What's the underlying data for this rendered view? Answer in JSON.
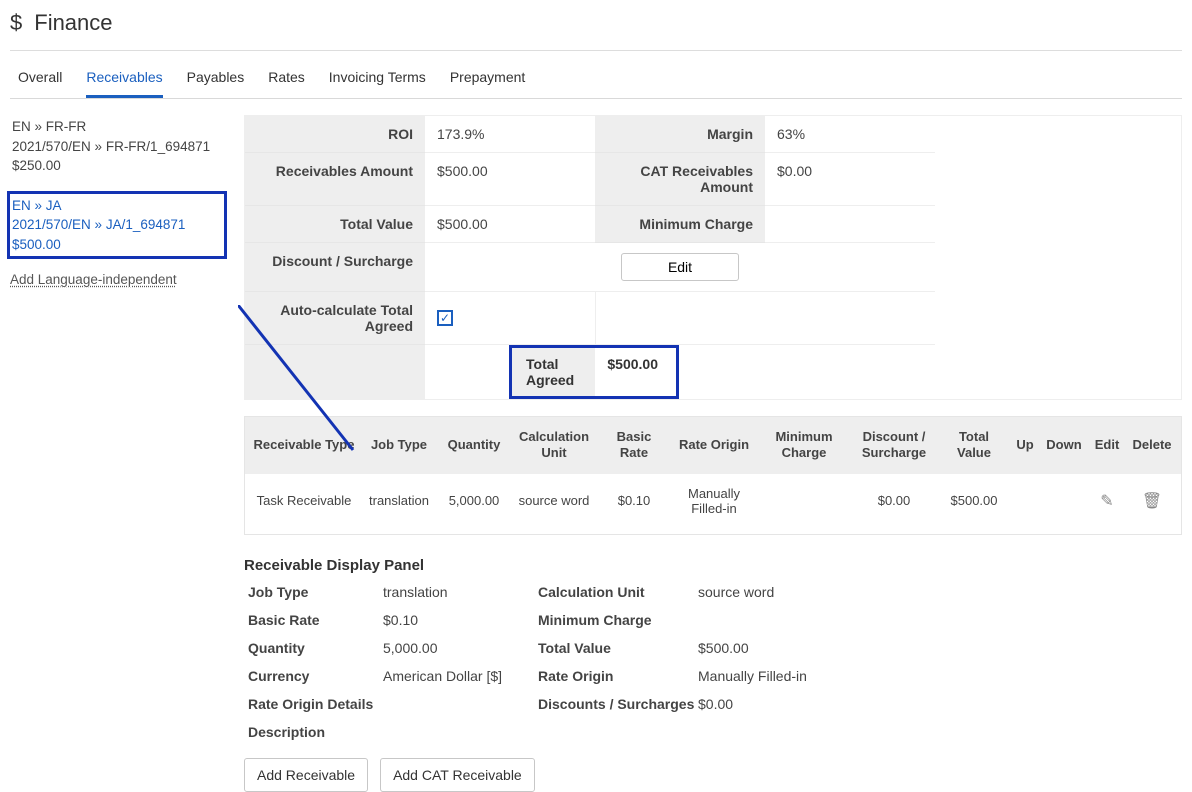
{
  "header": {
    "title": "Finance",
    "icon": "dollar-icon"
  },
  "tabs": {
    "items": [
      "Overall",
      "Receivables",
      "Payables",
      "Rates",
      "Invoicing Terms",
      "Prepayment"
    ],
    "active_index": 1
  },
  "sidebar": {
    "items": [
      {
        "pair": "EN » FR-FR",
        "ref": "2021/570/EN » FR-FR/1_694871",
        "amount": "$250.00",
        "active": false
      },
      {
        "pair": "EN » JA",
        "ref": "2021/570/EN » JA/1_694871",
        "amount": "$500.00",
        "active": true
      }
    ],
    "add_label": "Add Language-independent"
  },
  "summary": {
    "roi_label": "ROI",
    "roi": "173.9%",
    "margin_label": "Margin",
    "margin": "63%",
    "receivables_amount_label": "Receivables Amount",
    "receivables_amount": "$500.00",
    "cat_receivables_amount_label": "CAT Receivables Amount",
    "cat_receivables_amount": "$0.00",
    "total_value_label": "Total Value",
    "total_value": "$500.00",
    "minimum_charge_label": "Minimum Charge",
    "minimum_charge": "",
    "discount_label": "Discount / Surcharge",
    "edit_button": "Edit",
    "autocalc_label": "Auto-calculate Total Agreed",
    "autocalc_checked": true,
    "total_agreed_label": "Total Agreed",
    "total_agreed": "$500.00"
  },
  "table": {
    "headers": {
      "receivable_type": "Receivable Type",
      "job_type": "Job Type",
      "quantity": "Quantity",
      "calc_unit": "Calculation Unit",
      "basic_rate": "Basic Rate",
      "rate_origin": "Rate Origin",
      "min_charge": "Minimum Charge",
      "discount": "Discount / Surcharge",
      "total_value": "Total Value",
      "up": "Up",
      "down": "Down",
      "edit": "Edit",
      "delete": "Delete"
    },
    "rows": [
      {
        "receivable_type": "Task Receivable",
        "job_type": "translation",
        "quantity": "5,000.00",
        "calc_unit": "source word",
        "basic_rate": "$0.10",
        "rate_origin": "Manually Filled-in",
        "min_charge": "",
        "discount": "$0.00",
        "total_value": "$500.00"
      }
    ]
  },
  "panel": {
    "title": "Receivable Display Panel",
    "labels": {
      "job_type": "Job Type",
      "calc_unit": "Calculation Unit",
      "basic_rate": "Basic Rate",
      "min_charge": "Minimum Charge",
      "quantity": "Quantity",
      "total_value": "Total Value",
      "currency": "Currency",
      "rate_origin": "Rate Origin",
      "rate_origin_details": "Rate Origin Details",
      "discounts": "Discounts / Surcharges",
      "description": "Description"
    },
    "values": {
      "job_type": "translation",
      "calc_unit": "source word",
      "basic_rate": "$0.10",
      "min_charge": "",
      "quantity": "5,000.00",
      "total_value": "$500.00",
      "currency": "American Dollar [$]",
      "rate_origin": "Manually Filled-in",
      "rate_origin_details": "",
      "discounts": "$0.00",
      "description": ""
    }
  },
  "buttons": {
    "add_receivable": "Add Receivable",
    "add_cat_receivable": "Add CAT Receivable"
  }
}
